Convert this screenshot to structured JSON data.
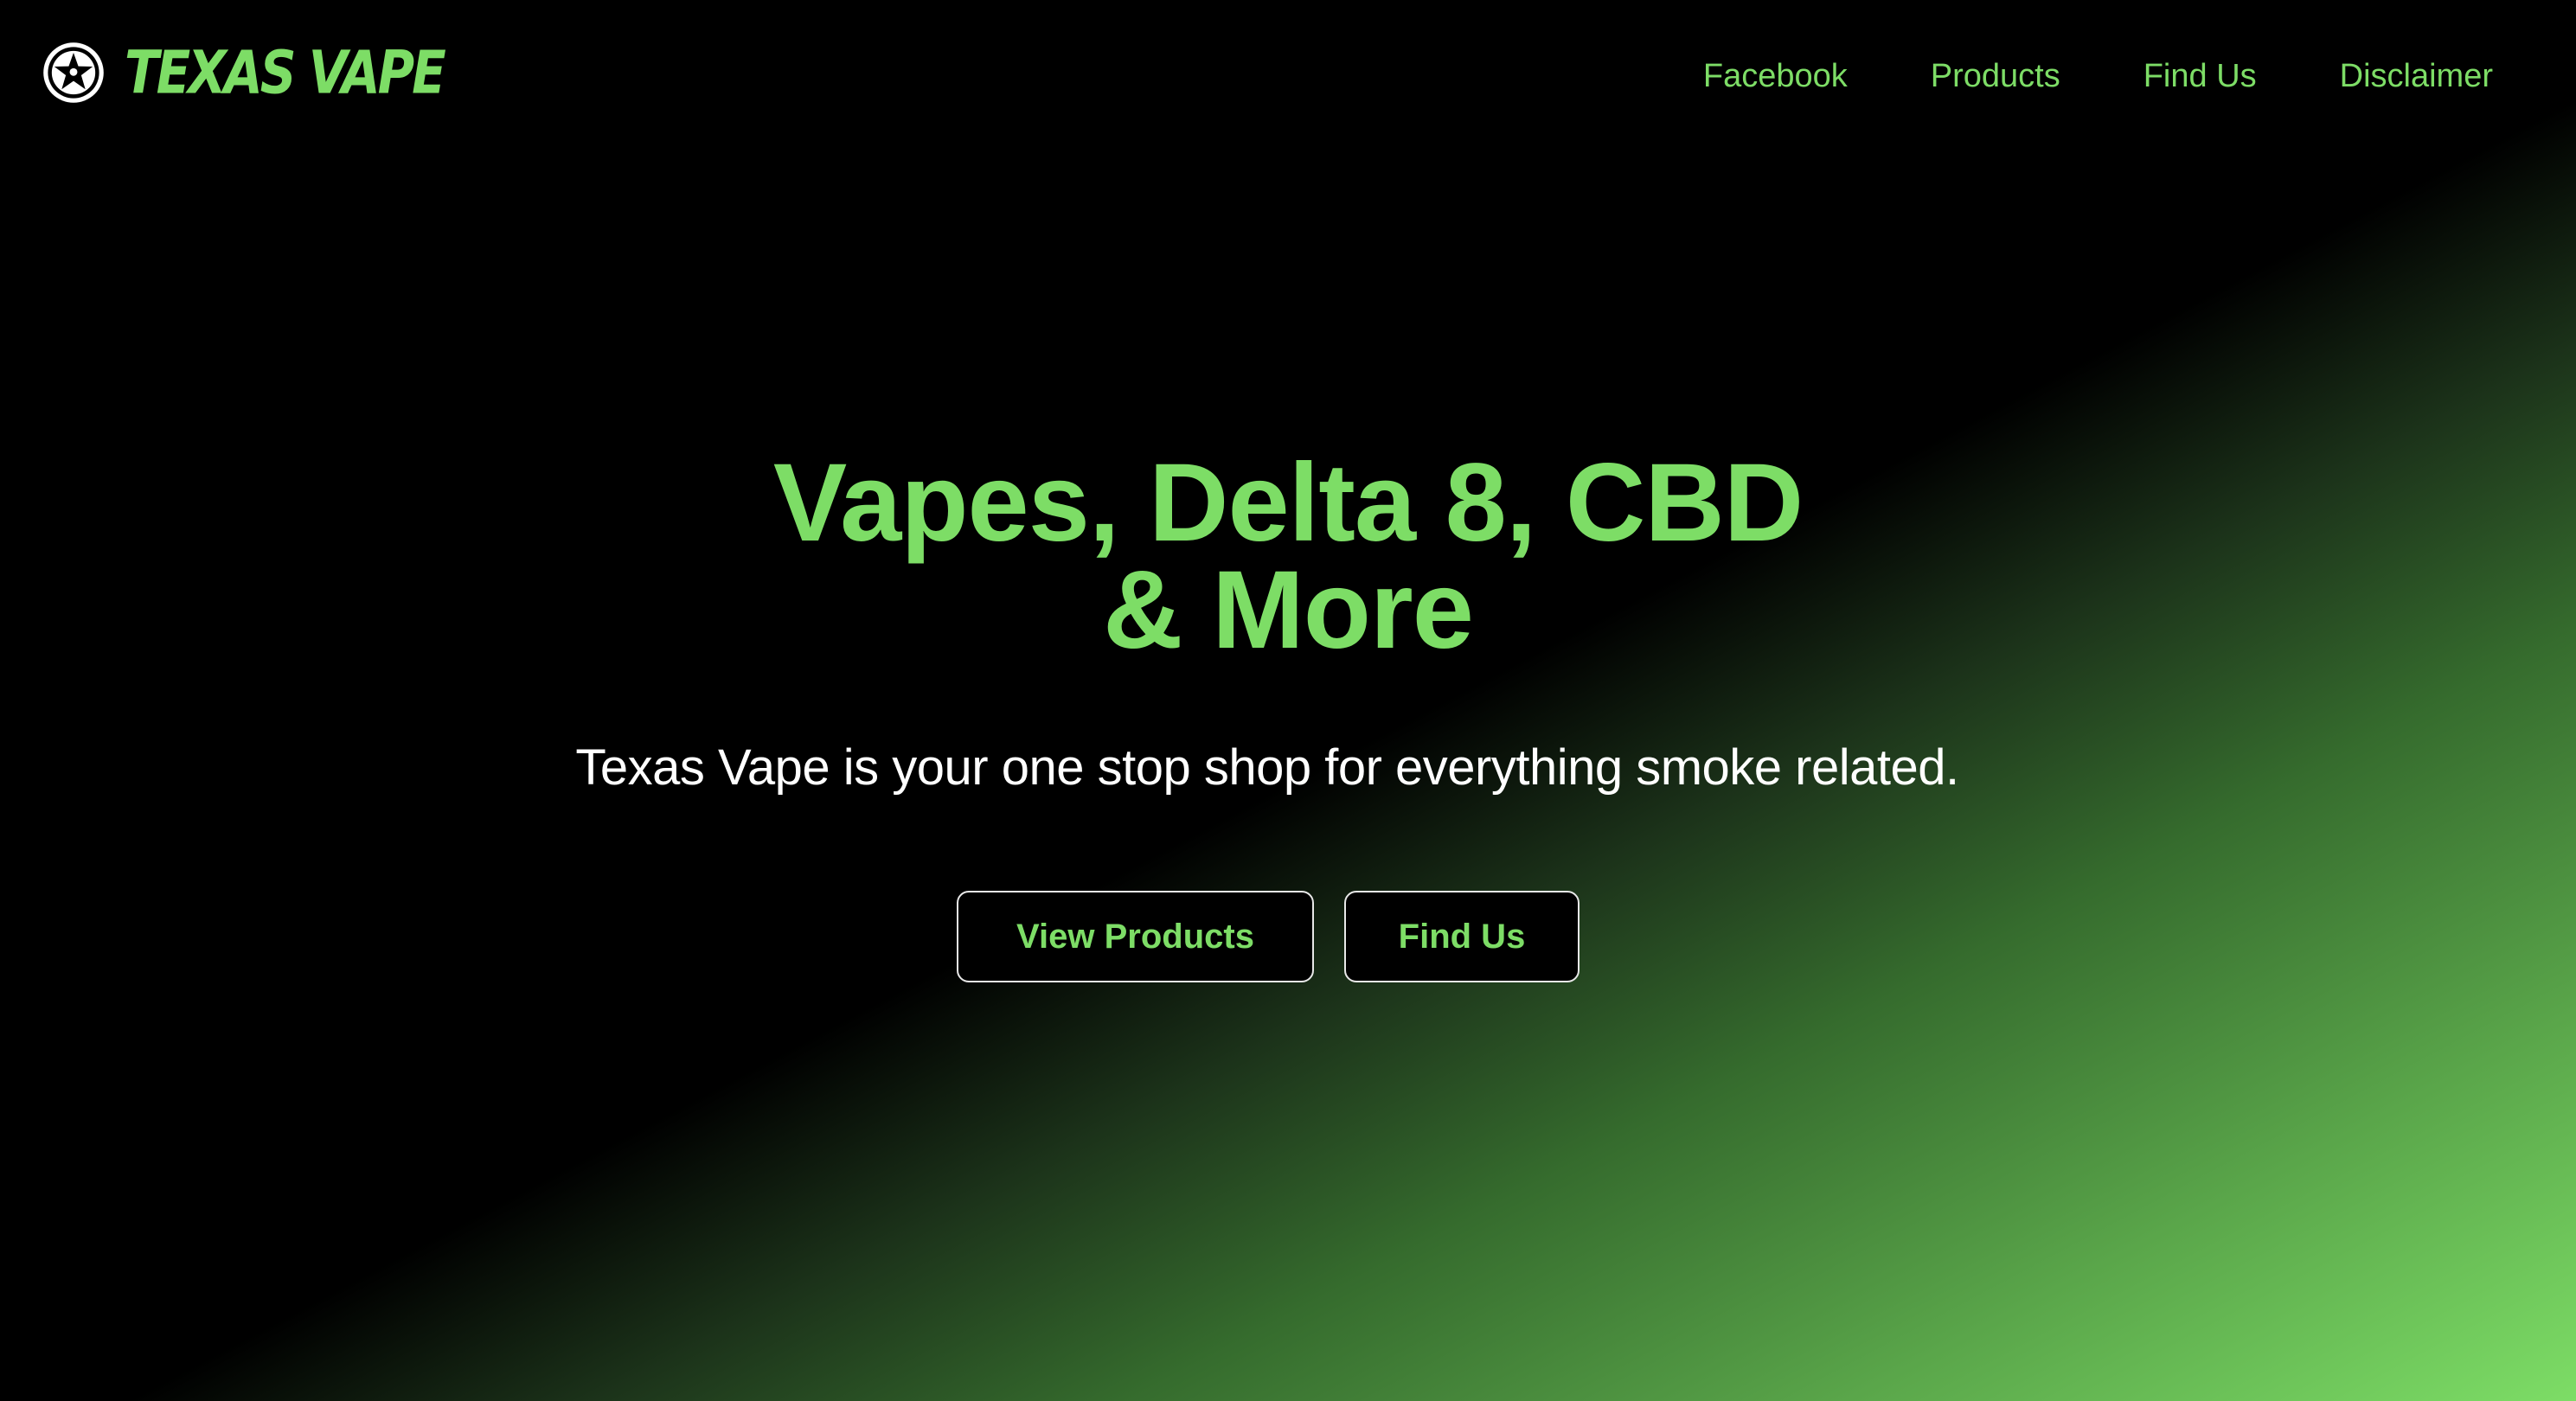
{
  "brand": {
    "name": "TEXAS VAPE",
    "icon": "star-badge-icon"
  },
  "nav": {
    "links": [
      {
        "label": "Facebook"
      },
      {
        "label": "Products"
      },
      {
        "label": "Find Us"
      },
      {
        "label": "Disclaimer"
      }
    ]
  },
  "hero": {
    "title_line1": "Vapes, Delta 8, CBD",
    "title_line2": "& More",
    "subtitle": "Texas Vape is your one stop shop for everything smoke related.",
    "buttons": {
      "view_products": "View Products",
      "find_us": "Find Us"
    }
  },
  "colors": {
    "accent": "#7ddd66",
    "background": "#000000",
    "text": "#ffffff",
    "button_border": "#e8e8e8"
  }
}
